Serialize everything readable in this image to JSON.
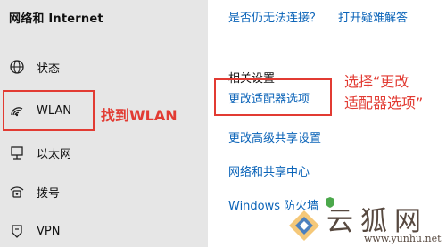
{
  "sidebar": {
    "title": "网络和 Internet",
    "items": [
      {
        "label": "状态",
        "icon": "globe-icon"
      },
      {
        "label": "WLAN",
        "icon": "wifi-icon"
      },
      {
        "label": "以太网",
        "icon": "ethernet-icon"
      },
      {
        "label": "拨号",
        "icon": "dial-up-icon"
      },
      {
        "label": "VPN",
        "icon": "vpn-icon"
      }
    ]
  },
  "main": {
    "help_question": "是否仍无法连接？",
    "troubleshooter_link": "打开疑难解答",
    "related_settings_heading": "相关设置",
    "change_adapter_options": "更改适配器选项",
    "change_sharing_options": "更改高级共享设置",
    "network_sharing_center": "网络和共享中心",
    "windows_firewall": "Windows 防火墙"
  },
  "annotations": {
    "find_wlan": "找到WLAN",
    "select_change_adapter_line1": "选择“更改",
    "select_change_adapter_line2": "适配器选项”",
    "color": "#e23b33"
  },
  "watermark": {
    "chinese": "云狐网",
    "url": "www.yunhu.net"
  },
  "colors": {
    "sidebar_bg": "#e6e6e6",
    "link": "#0a63b8",
    "annotation": "#e23b33"
  }
}
